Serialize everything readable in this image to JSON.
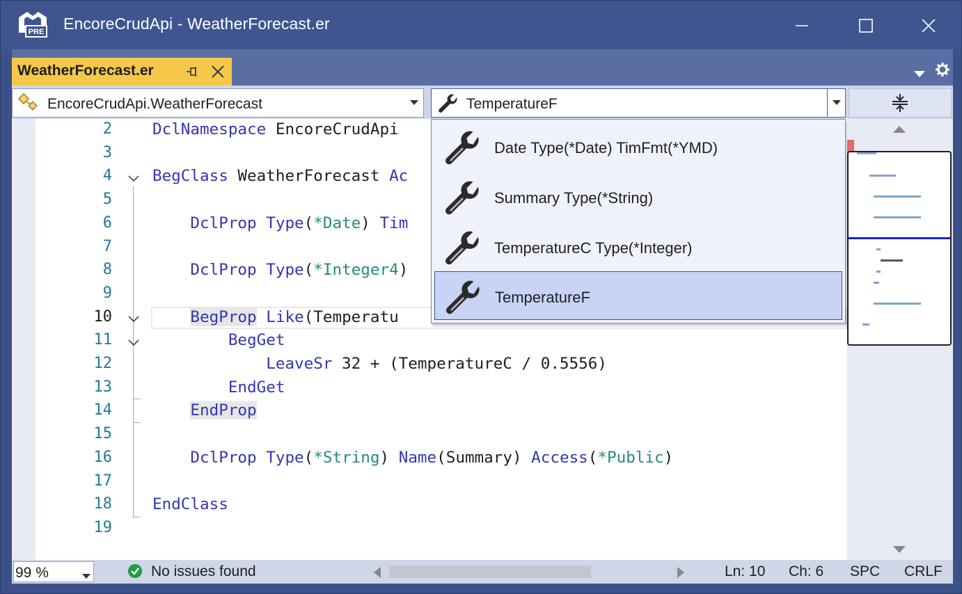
{
  "window": {
    "title": "EncoreCrudApi - WeatherForecast.er",
    "icon_badge": "PRE"
  },
  "tab": {
    "label": "WeatherForecast.er"
  },
  "navbar": {
    "class_combo": "EncoreCrudApi.WeatherForecast",
    "member_combo": "TemperatureF"
  },
  "editor": {
    "line_numbers": [
      "2",
      "3",
      "4",
      "5",
      "6",
      "7",
      "8",
      "9",
      "10",
      "11",
      "12",
      "13",
      "14",
      "15",
      "16",
      "17",
      "18",
      "19"
    ],
    "current_line": "10",
    "lines": [
      {
        "n": "2",
        "parts": [
          [
            "kw",
            "DclNamespace"
          ],
          [
            "t",
            " EncoreCrudApi"
          ]
        ]
      },
      {
        "n": "3",
        "parts": []
      },
      {
        "n": "4",
        "parts": [
          [
            "kw",
            "BegClass"
          ],
          [
            "t",
            " WeatherForecast "
          ],
          [
            "kw",
            "Ac"
          ]
        ]
      },
      {
        "n": "5",
        "parts": []
      },
      {
        "n": "6",
        "parts": [
          [
            "t",
            "    "
          ],
          [
            "kw",
            "DclProp"
          ],
          [
            "t",
            " "
          ],
          [
            "kw",
            "Type"
          ],
          [
            "t",
            "("
          ],
          [
            "sv",
            "*Date"
          ],
          [
            "t",
            ") "
          ],
          [
            "kw",
            "Tim"
          ]
        ]
      },
      {
        "n": "7",
        "parts": []
      },
      {
        "n": "8",
        "parts": [
          [
            "t",
            "    "
          ],
          [
            "kw",
            "DclProp"
          ],
          [
            "t",
            " "
          ],
          [
            "kw",
            "Type"
          ],
          [
            "t",
            "("
          ],
          [
            "sv",
            "*Integer4"
          ],
          [
            "t",
            ")"
          ]
        ]
      },
      {
        "n": "9",
        "parts": []
      },
      {
        "n": "10",
        "parts": [
          [
            "t",
            "    "
          ],
          [
            "kwhl",
            "BegProp"
          ],
          [
            "t",
            " "
          ],
          [
            "kw",
            "Like"
          ],
          [
            "t",
            "(Temperatu"
          ]
        ]
      },
      {
        "n": "11",
        "parts": [
          [
            "t",
            "        "
          ],
          [
            "kw",
            "BegGet"
          ]
        ]
      },
      {
        "n": "12",
        "parts": [
          [
            "t",
            "            "
          ],
          [
            "kw",
            "LeaveSr"
          ],
          [
            "t",
            " 32 + (TemperatureC / 0.5556)"
          ]
        ]
      },
      {
        "n": "13",
        "parts": [
          [
            "t",
            "        "
          ],
          [
            "kw",
            "EndGet"
          ]
        ]
      },
      {
        "n": "14",
        "parts": [
          [
            "t",
            "    "
          ],
          [
            "kwhl",
            "EndProp"
          ]
        ]
      },
      {
        "n": "15",
        "parts": []
      },
      {
        "n": "16",
        "parts": [
          [
            "t",
            "    "
          ],
          [
            "kw",
            "DclProp"
          ],
          [
            "t",
            " "
          ],
          [
            "kw",
            "Type"
          ],
          [
            "t",
            "("
          ],
          [
            "sv",
            "*String"
          ],
          [
            "t",
            ") "
          ],
          [
            "kw",
            "Name"
          ],
          [
            "t",
            "(Summary) "
          ],
          [
            "kw",
            "Access"
          ],
          [
            "t",
            "("
          ],
          [
            "sv",
            "*Public"
          ],
          [
            "t",
            ")"
          ]
        ]
      },
      {
        "n": "17",
        "parts": []
      },
      {
        "n": "18",
        "parts": [
          [
            "kw",
            "EndClass"
          ]
        ]
      },
      {
        "n": "19",
        "parts": []
      }
    ]
  },
  "dropdown": {
    "items": [
      {
        "label": "Date Type(*Date) TimFmt(*YMD)",
        "selected": false
      },
      {
        "label": "Summary Type(*String)",
        "selected": false
      },
      {
        "label": "TemperatureC Type(*Integer)",
        "selected": false
      },
      {
        "label": "TemperatureF",
        "selected": true
      }
    ]
  },
  "statusbar": {
    "zoom": "99 %",
    "issues": "No issues found",
    "line": "Ln: 10",
    "char": "Ch: 6",
    "spacing": "SPC",
    "line_ending": "CRLF"
  },
  "colors": {
    "titlebar": "#3f5590",
    "tab_active": "#f5c84a",
    "keyword": "#3535b4",
    "special_value": "#26897a",
    "line_number": "#237a93",
    "dropdown_selected": "#c7d4f5",
    "ok_icon": "#1f9e3f"
  },
  "icons": [
    "app-pre-icon",
    "minimize-icon",
    "maximize-icon",
    "close-icon",
    "pin-icon",
    "tab-close-icon",
    "chevron-down-icon",
    "gear-icon",
    "class-icon",
    "wrench-icon",
    "split-icon",
    "fold-chevron-icon",
    "check-circle-icon",
    "scroll-left-icon",
    "scroll-right-icon",
    "scroll-up-icon",
    "scroll-down-icon"
  ]
}
